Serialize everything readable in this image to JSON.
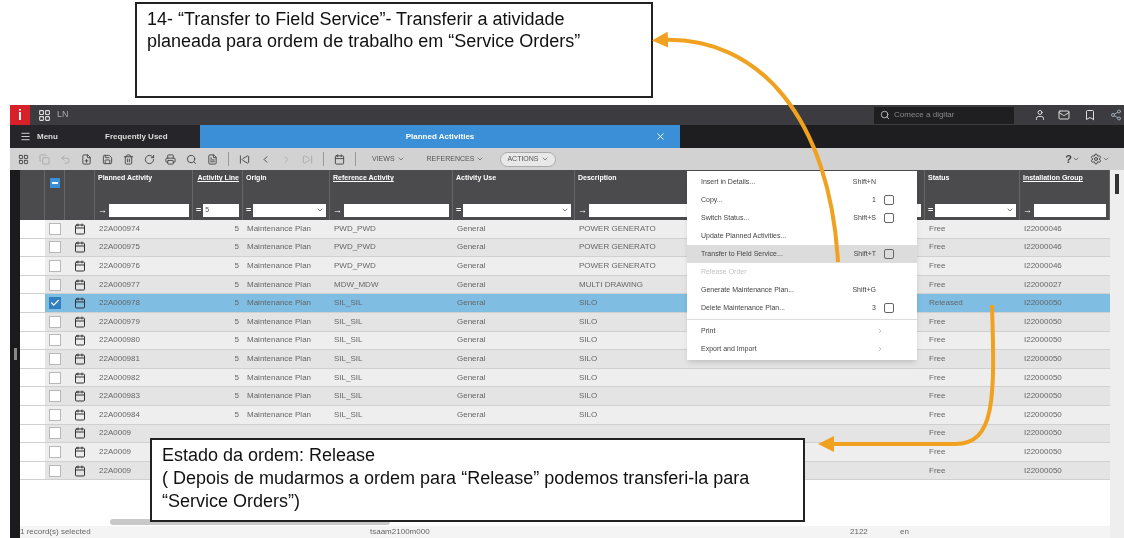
{
  "callouts": [
    {
      "text": "14- “Transfer to Field Service”- Transferir a atividade planeada para ordem de trabalho em “Service Orders”"
    },
    {
      "title": "Estado da ordem: Release",
      "text": "( Depois de mudarmos a ordem para “Release” podemos transferi-la para “Service Orders”)"
    }
  ],
  "app": {
    "logo": "i",
    "brand": "LN",
    "search": {
      "placeholder": "Comece a digitar"
    },
    "tabs": [
      {
        "label": "Menu",
        "kind": "menu",
        "selected": false
      },
      {
        "label": "Frequently Used",
        "kind": "plain",
        "selected": false
      },
      {
        "label": "Planned Activities",
        "kind": "document",
        "selected": true
      }
    ],
    "toolbar_menus": [
      {
        "label": "VIEWS",
        "open": false
      },
      {
        "label": "REFERENCES",
        "open": false
      },
      {
        "label": "ACTIONS",
        "open": true
      }
    ],
    "help": "?",
    "select_all": {
      "indeterminate": true
    },
    "columns": [
      {
        "label": "Planned Activity",
        "op": "→",
        "kind": "text",
        "underlined": false
      },
      {
        "label": "Activity Line",
        "op": "=",
        "kind": "number",
        "value": "5",
        "underlined": true
      },
      {
        "label": "Origin",
        "op": "=",
        "kind": "select",
        "underlined": false
      },
      {
        "label": "Reference Activity",
        "op": "→",
        "kind": "text",
        "underlined": true
      },
      {
        "label": "Activity Use",
        "op": "=",
        "kind": "select",
        "underlined": false
      },
      {
        "label": "Description",
        "op": "→",
        "kind": "text",
        "underlined": false
      },
      {
        "label": "Status",
        "op": "=",
        "kind": "select",
        "underlined": false
      },
      {
        "label": "Installation Group",
        "op": "→",
        "kind": "text",
        "underlined": true
      }
    ],
    "rows": [
      {
        "selected": false,
        "checked": false,
        "cells": [
          "22A000974",
          "5",
          "Maintenance Plan",
          "PWD_PWD",
          "General",
          "POWER GENERATO",
          "Free",
          "I22000046"
        ]
      },
      {
        "selected": false,
        "checked": false,
        "cells": [
          "22A000975",
          "5",
          "Maintenance Plan",
          "PWD_PWD",
          "General",
          "POWER GENERATO",
          "Free",
          "I22000046"
        ]
      },
      {
        "selected": false,
        "checked": false,
        "cells": [
          "22A000976",
          "5",
          "Maintenance Plan",
          "PWD_PWD",
          "General",
          "POWER GENERATO",
          "Free",
          "I22000046"
        ]
      },
      {
        "selected": false,
        "checked": false,
        "cells": [
          "22A000977",
          "5",
          "Maintenance Plan",
          "MDW_MDW",
          "General",
          "MULTI DRAWING",
          "Free",
          "I22000027"
        ]
      },
      {
        "selected": true,
        "checked": true,
        "cells": [
          "22A000978",
          "5",
          "Maintenance Plan",
          "SIL_SIL",
          "General",
          "SILO",
          "Released",
          "I22000050"
        ]
      },
      {
        "selected": false,
        "checked": false,
        "cells": [
          "22A000979",
          "5",
          "Maintenance Plan",
          "SIL_SIL",
          "General",
          "SILO",
          "Free",
          "I22000050"
        ]
      },
      {
        "selected": false,
        "checked": false,
        "cells": [
          "22A000980",
          "5",
          "Maintenance Plan",
          "SIL_SIL",
          "General",
          "SILO",
          "Free",
          "I22000050"
        ]
      },
      {
        "selected": false,
        "checked": false,
        "cells": [
          "22A000981",
          "5",
          "Maintenance Plan",
          "SIL_SIL",
          "General",
          "SILO",
          "Free",
          "I22000050"
        ]
      },
      {
        "selected": false,
        "checked": false,
        "cells": [
          "22A000982",
          "5",
          "Maintenance Plan",
          "SIL_SIL",
          "General",
          "SILO",
          "Free",
          "I22000050"
        ]
      },
      {
        "selected": false,
        "checked": false,
        "cells": [
          "22A000983",
          "5",
          "Maintenance Plan",
          "SIL_SIL",
          "General",
          "SILO",
          "Free",
          "I22000050"
        ]
      },
      {
        "selected": false,
        "checked": false,
        "cells": [
          "22A000984",
          "5",
          "Maintenance Plan",
          "SIL_SIL",
          "General",
          "SILO",
          "Free",
          "I22000050"
        ]
      },
      {
        "selected": false,
        "checked": false,
        "cells": [
          "22A0009",
          "",
          "",
          "",
          "",
          "",
          "Free",
          "I22000050"
        ]
      },
      {
        "selected": false,
        "checked": false,
        "cells": [
          "22A0009",
          "",
          "",
          "",
          "",
          "",
          "Free",
          "I22000050"
        ]
      },
      {
        "selected": false,
        "checked": false,
        "cells": [
          "22A0009",
          "",
          "",
          "",
          "",
          "",
          "Free",
          "I22000050"
        ]
      }
    ],
    "actions_menu": [
      {
        "kind": "item",
        "label": "Insert in Details...",
        "shortcut": "Shift+N",
        "toolbar_option": false,
        "selected": false,
        "disabled": false
      },
      {
        "kind": "item",
        "label": "Copy...",
        "shortcut": "1",
        "toolbar_option": true,
        "selected": false,
        "disabled": false
      },
      {
        "kind": "item",
        "label": "Switch Status...",
        "shortcut": "Shift+S",
        "toolbar_option": true,
        "selected": false,
        "disabled": false
      },
      {
        "kind": "item",
        "label": "Update Planned Activities...",
        "toolbar_option": false,
        "selected": false,
        "disabled": false
      },
      {
        "kind": "item",
        "label": "Transfer to Field Service...",
        "shortcut": "Shift+T",
        "toolbar_option": true,
        "selected": true,
        "disabled": false
      },
      {
        "kind": "item",
        "label": "Release Order",
        "toolbar_option": false,
        "selected": false,
        "disabled": true
      },
      {
        "kind": "item",
        "label": "Generate Maintenance Plan...",
        "shortcut": "Shift+G",
        "toolbar_option": false,
        "selected": false,
        "disabled": false
      },
      {
        "kind": "item",
        "label": "Delete Maintenance Plan...",
        "shortcut": "3",
        "toolbar_option": true,
        "selected": false,
        "disabled": false
      },
      {
        "kind": "separator"
      },
      {
        "kind": "submenu",
        "label": "Print",
        "selected": false,
        "disabled": false
      },
      {
        "kind": "submenu",
        "label": "Export and Import",
        "selected": false,
        "disabled": false
      }
    ],
    "status_bar": [
      "1 record(s) selected",
      "tsaam2100m000",
      "2122",
      "en"
    ]
  }
}
